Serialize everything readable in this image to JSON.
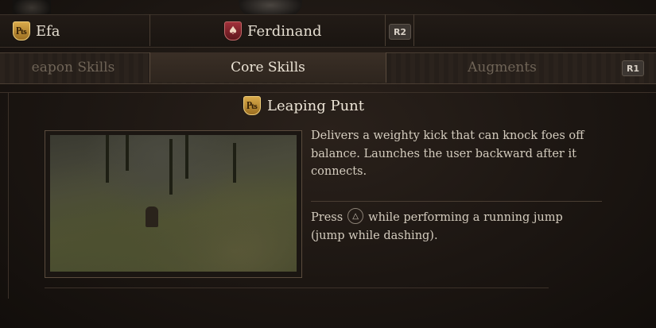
{
  "party": {
    "members": [
      {
        "name": "Efa",
        "crest_icon": "player-crest-icon"
      },
      {
        "name": "Ferdinand",
        "crest_icon": "pawn-crest-icon"
      }
    ],
    "next_button": "R2"
  },
  "tabs": {
    "items": [
      "eapon Skills",
      "Core Skills",
      "Augments"
    ],
    "active": "Core Skills",
    "next_button": "R1"
  },
  "skill": {
    "name": "Leaping Punt",
    "description": "Delivers a weighty kick that can knock foes off balance. Launches the user backward after it connects.",
    "howto_prefix": "Press",
    "howto_button": "triangle",
    "howto_suffix": "while performing a running jump (jump while dashing)."
  },
  "colors": {
    "crest_gold": "#c8962e",
    "crest_red": "#8a2430",
    "text_active": "#ece4d6",
    "text_inactive": "#6f6457"
  }
}
